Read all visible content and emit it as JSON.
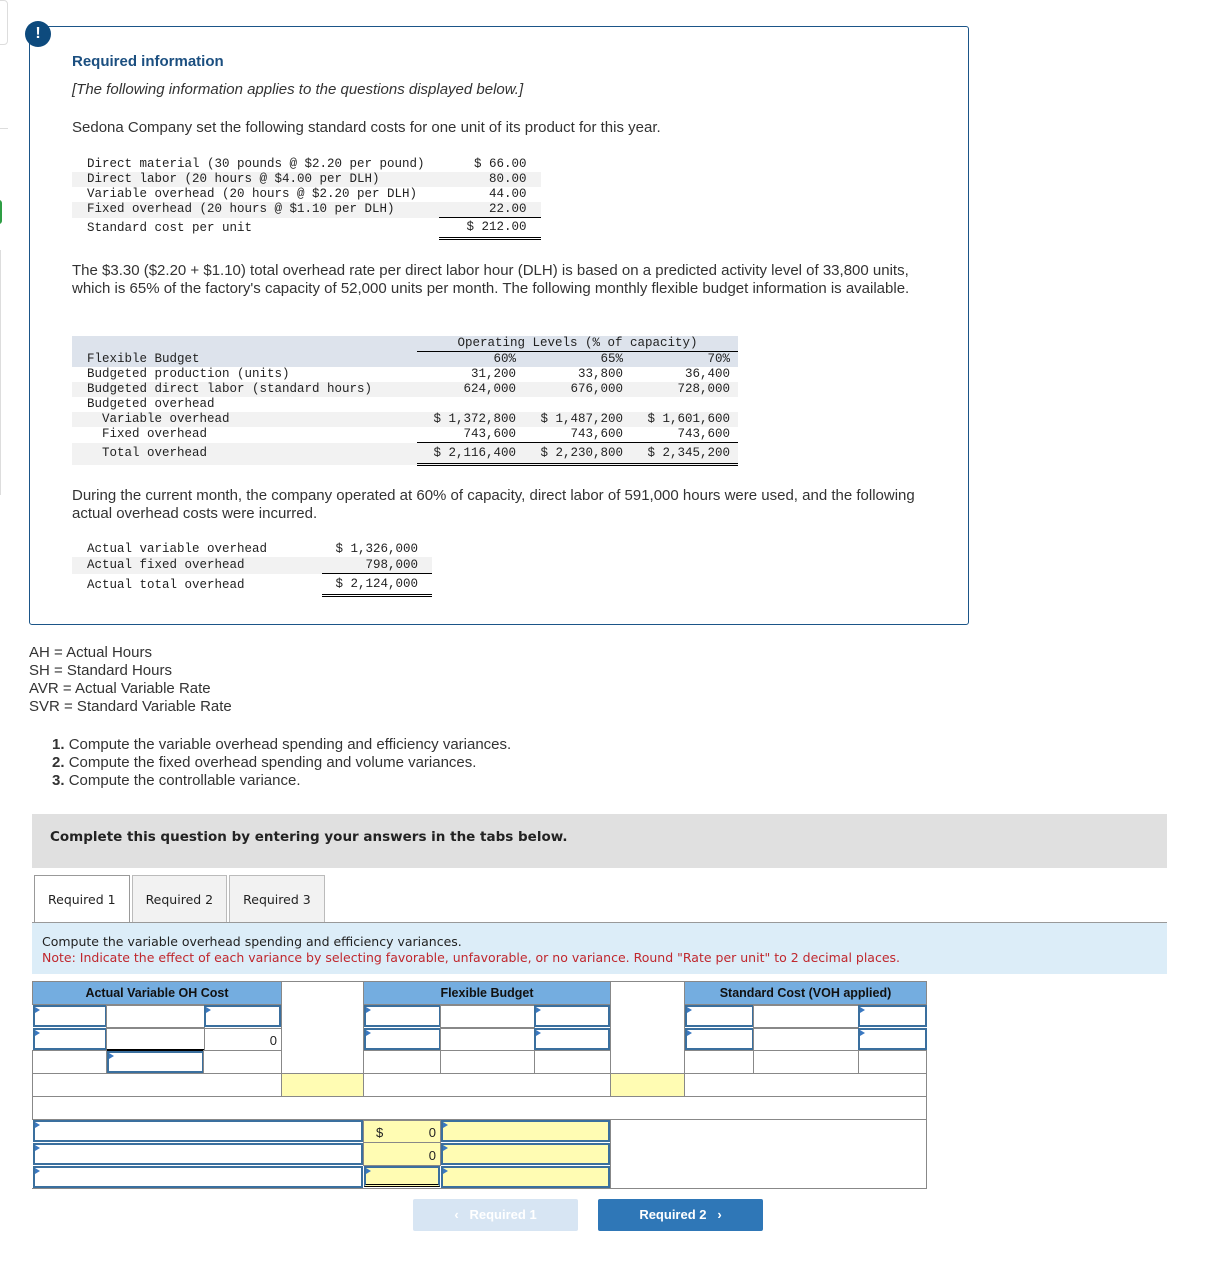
{
  "alert_icon": "!",
  "info": {
    "title": "Required information",
    "subtitle": "[The following information applies to the questions displayed below.]",
    "intro": "Sedona Company set the following standard costs for one unit of its product for this year.",
    "standard_costs": [
      {
        "label": "Direct material (30 pounds @ $2.20 per pound)",
        "value": "$ 66.00"
      },
      {
        "label": "Direct labor (20 hours @ $4.00 per DLH)",
        "value": "80.00"
      },
      {
        "label": "Variable overhead (20 hours @ $2.20 per DLH)",
        "value": "44.00"
      },
      {
        "label": "Fixed overhead (20 hours @ $1.10 per DLH)",
        "value": "22.00"
      },
      {
        "label": "Standard cost per unit",
        "value": "$ 212.00"
      }
    ],
    "paragraph2": "The $3.30 ($2.20 + $1.10) total overhead rate per direct labor hour (DLH) is based on a predicted activity level of 33,800 units, which is 65% of the factory's capacity of 52,000 units per month. The following monthly flexible budget information is available.",
    "flex_budget": {
      "group_header": "Operating Levels (% of capacity)",
      "title": "Flexible Budget",
      "levels": [
        "60%",
        "65%",
        "70%"
      ],
      "rows": [
        {
          "label": "Budgeted production (units)",
          "values": [
            "31,200",
            "33,800",
            "36,400"
          ]
        },
        {
          "label": "Budgeted direct labor (standard hours)",
          "values": [
            "624,000",
            "676,000",
            "728,000"
          ]
        },
        {
          "label": "Budgeted overhead",
          "values": [
            "",
            "",
            ""
          ]
        },
        {
          "label": "  Variable overhead",
          "values": [
            "$ 1,372,800",
            "$ 1,487,200",
            "$ 1,601,600"
          ]
        },
        {
          "label": "  Fixed overhead",
          "values": [
            "743,600",
            "743,600",
            "743,600"
          ]
        },
        {
          "label": "  Total overhead",
          "values": [
            "$ 2,116,400",
            "$ 2,230,800",
            "$ 2,345,200"
          ]
        }
      ]
    },
    "paragraph3": "During the current month, the company operated at 60% of capacity, direct labor of 591,000 hours were used, and the following actual overhead costs were incurred.",
    "actual_overhead": [
      {
        "label": "Actual variable overhead",
        "value": "$ 1,326,000"
      },
      {
        "label": "Actual fixed overhead",
        "value": "798,000"
      },
      {
        "label": "Actual total overhead",
        "value": "$ 2,124,000"
      }
    ]
  },
  "legend": [
    "AH = Actual Hours",
    "SH = Standard Hours",
    "AVR = Actual Variable Rate",
    "SVR = Standard Variable Rate"
  ],
  "questions": [
    {
      "num": "1.",
      "text": "Compute the variable overhead spending and efficiency variances."
    },
    {
      "num": "2.",
      "text": "Compute the fixed overhead spending and volume variances."
    },
    {
      "num": "3.",
      "text": "Compute the controllable variance."
    }
  ],
  "complete_prompt": "Complete this question by entering your answers in the tabs below.",
  "tabs": [
    {
      "label": "Required 1",
      "active": true
    },
    {
      "label": "Required 2",
      "active": false
    },
    {
      "label": "Required 3",
      "active": false
    }
  ],
  "instructions": {
    "line1": "Compute the variable overhead spending and efficiency variances.",
    "note": "Note: Indicate the effect of each variance by selecting favorable, unfavorable, or no variance. Round \"Rate per unit\" to 2 decimal places."
  },
  "worksheet": {
    "headers": [
      "Actual Variable OH Cost",
      "Flexible Budget",
      "Standard Cost (VOH applied)"
    ],
    "actual_total": "0",
    "summary": [
      {
        "prefix": "$",
        "value": "0"
      },
      {
        "prefix": "",
        "value": "0"
      },
      {
        "prefix": "",
        "value": ""
      }
    ]
  },
  "nav": {
    "prev_label": "Required 1",
    "next_label": "Required 2",
    "prev_icon": "‹",
    "next_icon": "›"
  }
}
